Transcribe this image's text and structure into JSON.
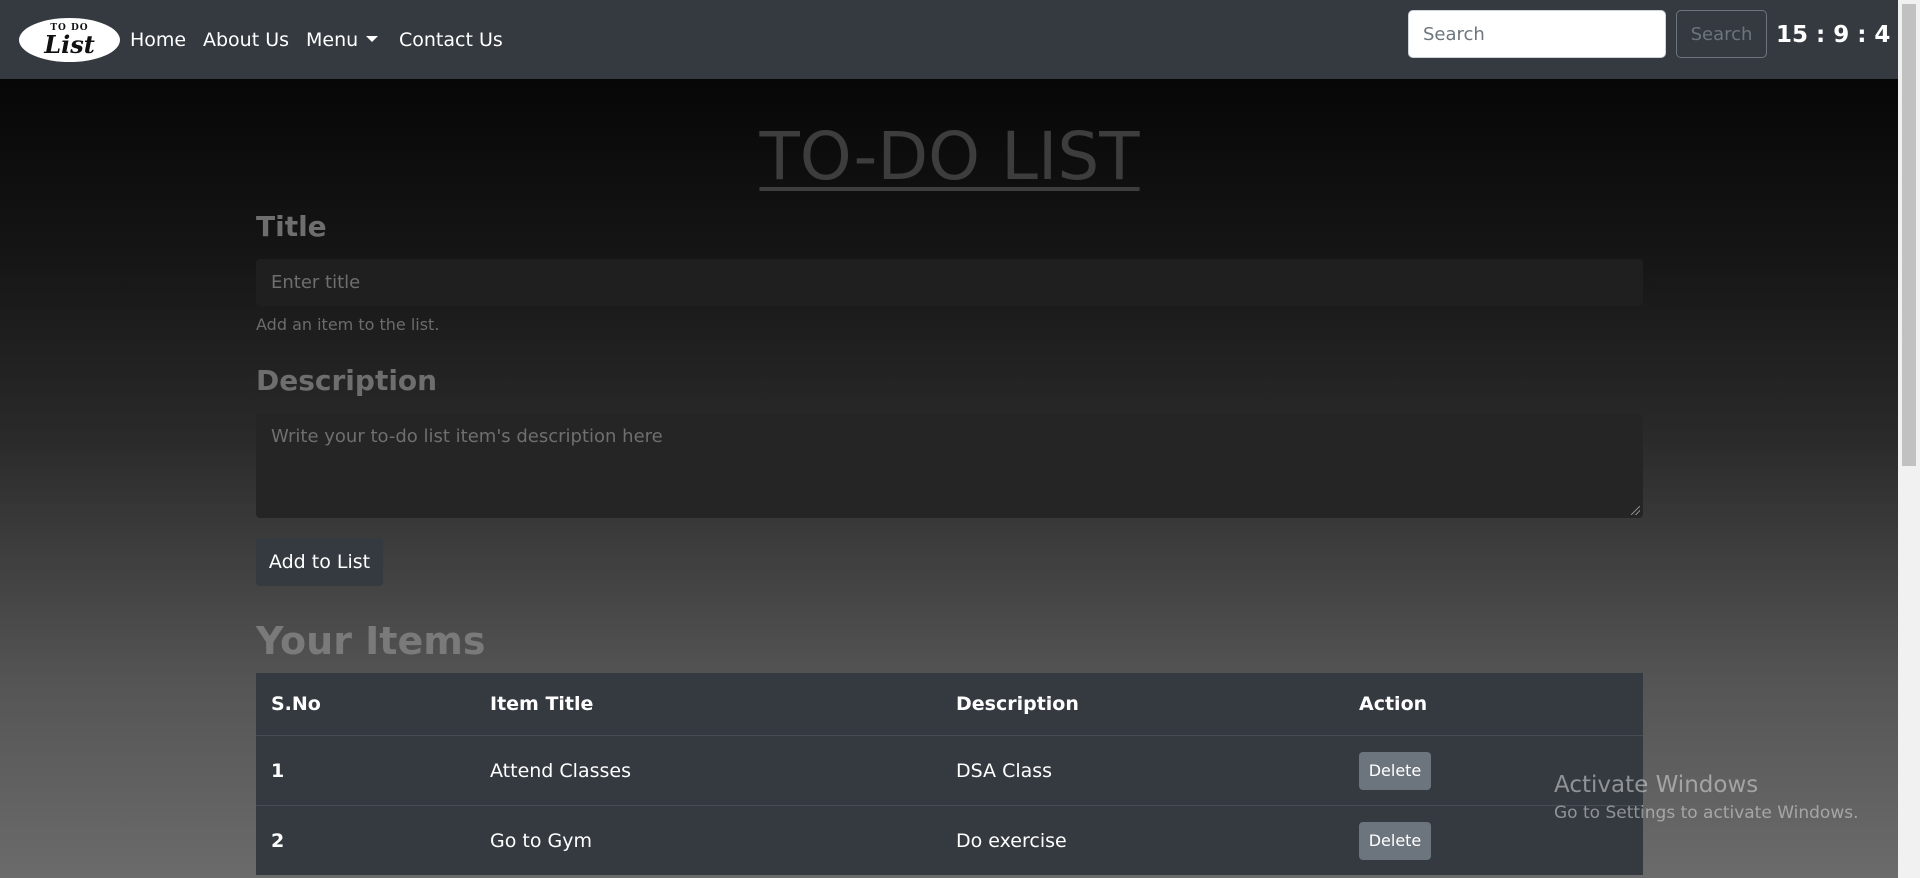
{
  "navbar": {
    "logo_top": "TO DO",
    "logo_main": "List",
    "links": [
      "Home",
      "About Us",
      "Menu",
      "Contact Us"
    ],
    "search_placeholder": "Search",
    "search_button": "Search",
    "clock": "15 : 9 : 4"
  },
  "main": {
    "page_title": "TO-DO LIST",
    "title_label": "Title",
    "title_placeholder": "Enter title",
    "title_help": "Add an item to the list.",
    "description_label": "Description",
    "description_placeholder": "Write your to-do list item's description here",
    "add_button": "Add to List",
    "items_heading": "Your Items"
  },
  "table": {
    "headers": [
      "S.No",
      "Item Title",
      "Description",
      "Action"
    ],
    "rows": [
      {
        "sno": "1",
        "title": "Attend Classes",
        "description": "DSA Class",
        "action": "Delete"
      },
      {
        "sno": "2",
        "title": "Go to Gym",
        "description": "Do exercise",
        "action": "Delete"
      }
    ]
  },
  "watermark": {
    "line1": "Activate Windows",
    "line2": "Go to Settings to activate Windows."
  }
}
